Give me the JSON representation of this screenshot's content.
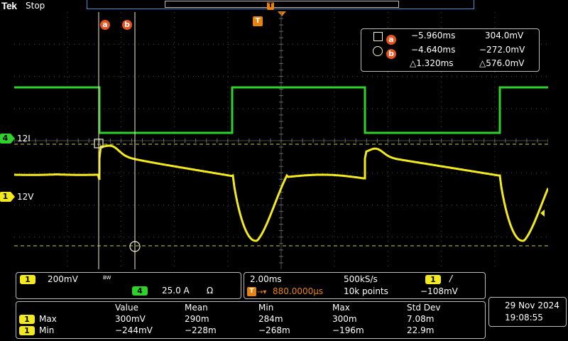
{
  "header": {
    "logo": "Tek",
    "acq_state": "Stop",
    "trigger_marker": "T"
  },
  "cursors": {
    "a_label": "a",
    "b_label": "b",
    "trigger_label": "T",
    "readout": {
      "row_a": {
        "time": "−5.960ms",
        "value": "304.0mV"
      },
      "row_b": {
        "time": "−4.640ms",
        "value": "−272.0mV"
      },
      "delta": {
        "time": "△1.320ms",
        "value": "△576.0mV"
      }
    }
  },
  "channels": {
    "ch4": {
      "number": "4",
      "label": "12I",
      "color": "#2fd12b"
    },
    "ch1": {
      "number": "1",
      "label": "12V",
      "color": "#f3ea1e"
    }
  },
  "vertical_panel": {
    "ch1_num": "1",
    "ch1_scale": "200mV",
    "bw_mark": "BW",
    "ch4_num": "4",
    "ch4_scale": "25.0 A",
    "ch4_term": "Ω"
  },
  "horizontal_panel": {
    "timebase": "2.00ms",
    "sample_rate": "500kS/s",
    "trig_source": "1",
    "trig_slope": "/",
    "trig_pos_icon": "T",
    "trig_pos": "880.0000µs",
    "record_length": "10k points",
    "trig_level": "−108mV"
  },
  "measurements": {
    "headers": [
      "Value",
      "Mean",
      "Min",
      "Max",
      "Std Dev"
    ],
    "rows": [
      {
        "ch": "1",
        "name": "Max",
        "values": [
          "300mV",
          "290m",
          "284m",
          "300m",
          "7.08m"
        ]
      },
      {
        "ch": "1",
        "name": "Min",
        "values": [
          "−244mV",
          "−228m",
          "−268m",
          "−196m",
          "22.9m"
        ]
      }
    ]
  },
  "datetime": {
    "date": "29 Nov 2024",
    "time": "19:08:55"
  },
  "colors": {
    "ch1": "#f3ea1e",
    "ch4": "#2fd12b",
    "cursor": "#f4f0c8",
    "accent": "#e8531f",
    "grid": "#5a5a5a"
  }
}
